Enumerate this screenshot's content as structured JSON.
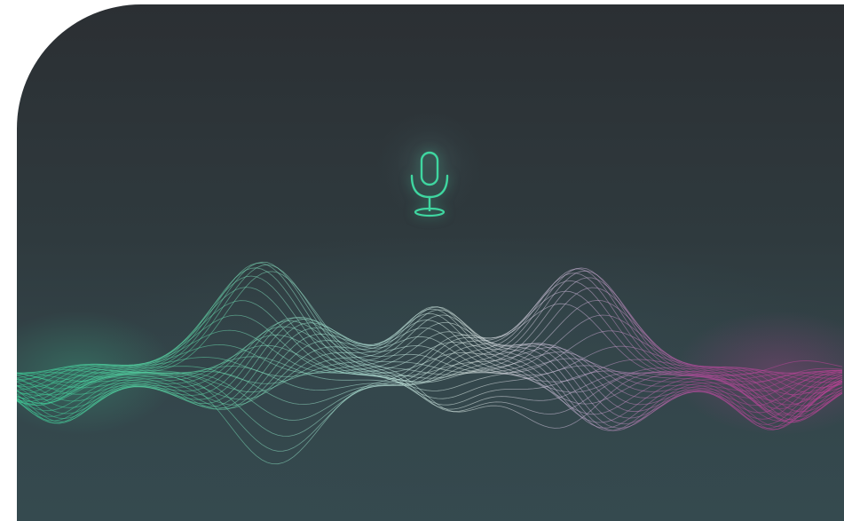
{
  "colors": {
    "background_top": "#2b2f33",
    "background_bottom": "#354a4f",
    "mic_accent": "#3fd6a0",
    "wave_start": "#3ed49c",
    "wave_mid": "#e6f2ee",
    "wave_end": "#c8409c"
  },
  "icons": {
    "microphone": "microphone-icon"
  },
  "state": "listening"
}
